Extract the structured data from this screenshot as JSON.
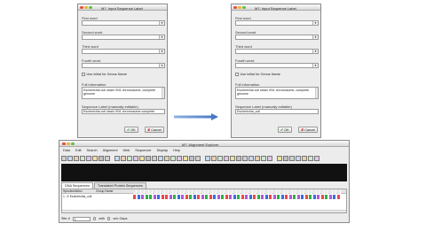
{
  "left_dialog": {
    "title": "M7: Input Sequence Label",
    "first_word_label": "First word",
    "first_word_value": "",
    "second_word_label": "Second word",
    "second_word_value": "",
    "third_word_label": "Third word",
    "third_word_value": "",
    "fourth_word_label": "Fourth word",
    "fourth_word_value": "",
    "initial_genus_label": "Use initial for Genus Name",
    "full_information_label": "Full information",
    "full_information_value": "Escherichia coli strain VN1 chromosome, complete genome",
    "sequence_label_label": "Sequence Label (manually editable)",
    "sequence_label_value": "Escherichia coli strain VN1 chromosome complete",
    "ok_label": "OK",
    "cancel_label": "Cancel"
  },
  "right_dialog": {
    "title": "M7: Input Sequence Label",
    "first_word_label": "First word",
    "first_word_value": "",
    "second_word_label": "Second word",
    "second_word_value": "",
    "third_word_label": "Third word",
    "third_word_value": "",
    "fourth_word_label": "Fourth word",
    "fourth_word_value": "",
    "initial_genus_label": "Use initial for Genus Name",
    "full_information_label": "Full information",
    "full_information_value": "Escherichia coli strain VN1 chromosome, complete genome",
    "sequence_label_label": "Sequence Label (manually editable)",
    "sequence_label_value": "Escherichia_coli",
    "ok_label": "OK",
    "cancel_label": "Cancel"
  },
  "alignment_window": {
    "title": "M7: Alignment Explorer",
    "menu": [
      "Data",
      "Edit",
      "Search",
      "Alignment",
      "Web",
      "Sequencer",
      "Display",
      "Help"
    ],
    "tabs": [
      "DNA Sequences",
      "Translated Protein Sequences"
    ],
    "column_headers": {
      "species": "Species/Abbrv",
      "group": "Group Name"
    },
    "sequence_row": {
      "index": "1.",
      "name": "Escherichia_coli"
    },
    "nucleotide_colors": {
      "A": "#e94b4b",
      "C": "#3a6fe0",
      "G": "#b15ad6",
      "T": "#2fae48"
    },
    "status": {
      "site_label": "Site #",
      "site_value": "1",
      "with_label": "with",
      "wo_gaps_label": "w/o Gaps"
    }
  }
}
